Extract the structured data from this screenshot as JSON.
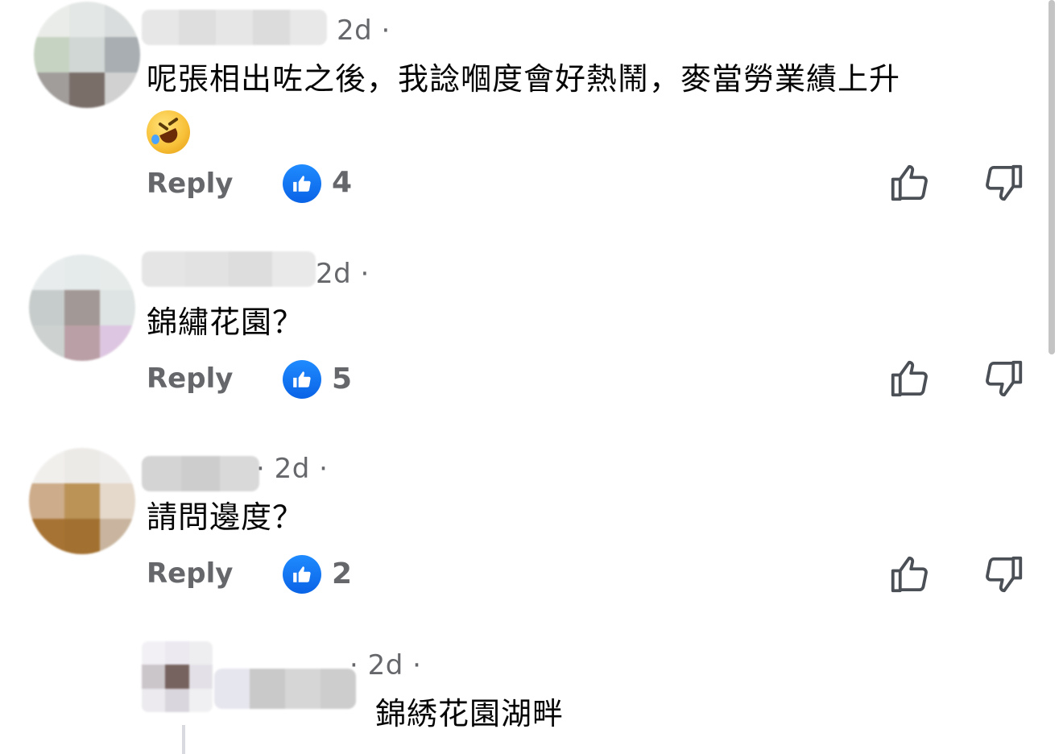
{
  "comments": [
    {
      "time": "2d ·",
      "text": "呢張相出咗之後，我諗嗰度會好熱鬧，麥當勞業績上升",
      "emoji": "rolling-on-floor-laughing",
      "reply_label": "Reply",
      "likes": "4"
    },
    {
      "time": "2d ·",
      "text": "錦繡花園？",
      "reply_label": "Reply",
      "likes": "5"
    },
    {
      "time": "· 2d ·",
      "text": "請問邊度？",
      "reply_label": "Reply",
      "likes": "2"
    },
    {
      "time": "· 2d ·",
      "text": "錦綉花園湖畔"
    }
  ],
  "icons": {
    "like_badge": "thumbs-up-badge-icon",
    "upvote": "thumbs-up-outline-icon",
    "downvote": "thumbs-down-outline-icon"
  },
  "colors": {
    "meta_text": "#65676b",
    "like_blue": "#0a63e6",
    "scrollbar": "#c4c4c4"
  }
}
